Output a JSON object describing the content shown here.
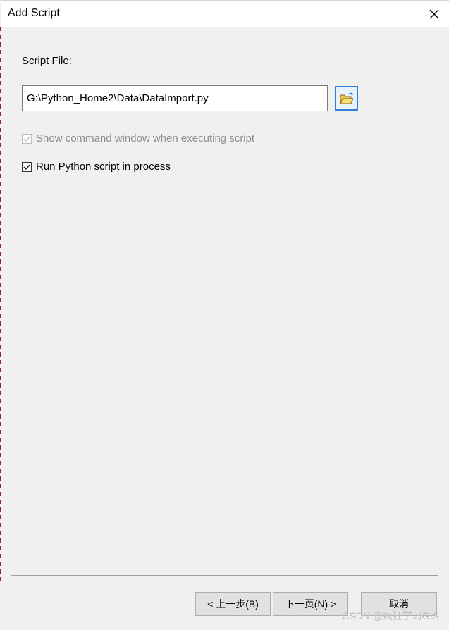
{
  "window": {
    "title": "Add Script",
    "close_glyph": "✕"
  },
  "script_file": {
    "label": "Script File:",
    "value": "G:\\Python_Home2\\Data\\DataImport.py",
    "browse_icon": "open-folder-icon"
  },
  "options": [
    {
      "label": "Show command window when executing script",
      "checked": true,
      "enabled": false
    },
    {
      "label": "Run Python script in process",
      "checked": true,
      "enabled": true
    }
  ],
  "buttons": {
    "back": "< 上一步(B)",
    "next": "下一页(N) >",
    "cancel": "取消"
  },
  "watermark": "CSDN @疯狂学习GIS",
  "colors": {
    "focus_border": "#2f7fd6",
    "folder_yellow": "#f2c94c",
    "disabled_text": "#8d8d8d"
  }
}
